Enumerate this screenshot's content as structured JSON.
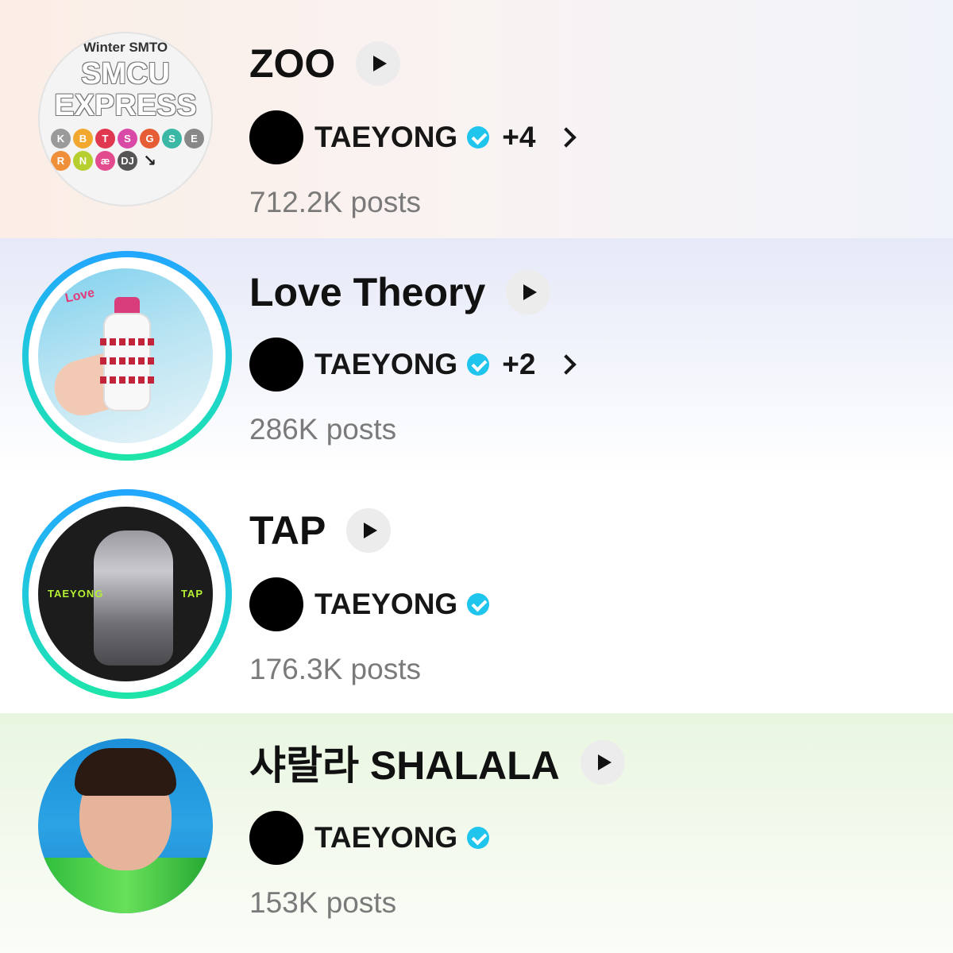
{
  "songs": [
    {
      "title": "ZOO",
      "artist": "TAEYONG",
      "more": "+4",
      "posts": "712.2K posts",
      "cover_lines": [
        "Winter SMTO",
        "SMCU",
        "EXPRESS"
      ],
      "cover_badges": [
        "K",
        "B",
        "T",
        "S",
        "G",
        "S",
        "E",
        "R",
        "N",
        "æ",
        "DJ",
        "↘"
      ]
    },
    {
      "title": "Love Theory",
      "artist": "TAEYONG",
      "more": "+2",
      "posts": "286K posts",
      "cover_text": "Love"
    },
    {
      "title": "TAP",
      "artist": "TAEYONG",
      "more": "",
      "posts": "176.3K posts",
      "cover_left": "TAEYONG",
      "cover_right": "TAP"
    },
    {
      "title": "샤랄라 SHALALA",
      "artist": "TAEYONG",
      "more": "",
      "posts": "153K posts"
    }
  ],
  "colors": {
    "verified": "#20c5ee",
    "ring_top": "#22a6ff",
    "ring_bottom": "#1ee5a8"
  },
  "icons": {
    "play": "play-icon",
    "verified": "verified-check-icon",
    "chevron": "chevron-right-icon"
  }
}
